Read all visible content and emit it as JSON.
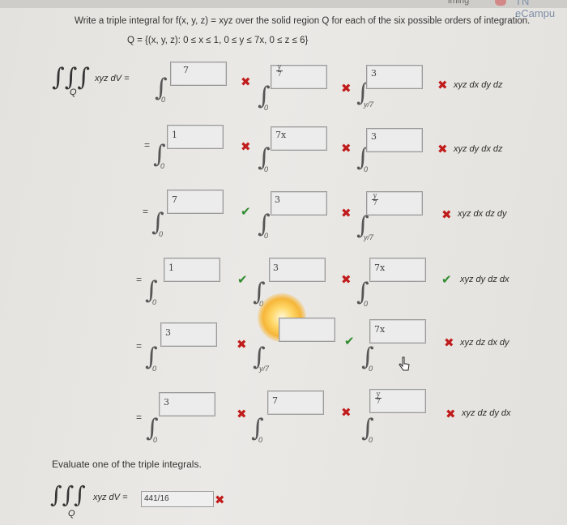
{
  "topbar": {
    "left_text": "iming",
    "brand": "TN eCampu"
  },
  "problem": {
    "statement": "Write a triple integral for f(x, y, z) = xyz over the solid region Q for each of the six possible orders of integration.",
    "region": "Q = {(x, y, z): 0 ≤ x ≤ 1, 0 ≤ y ≤ 7x, 0 ≤ z ≤ 6}",
    "triple_integral_symbol": "∫∫∫",
    "integrand_label": "xyz dV =",
    "region_symbol": "Q"
  },
  "eq": "=",
  "rows": [
    {
      "upper1": "7",
      "lower1": "0",
      "upper2_num": "y",
      "upper2_den": "7",
      "lower2": "0",
      "upper3": "3",
      "lower3": "y/7",
      "order": "xyz dx dy dz"
    },
    {
      "upper1": "1",
      "lower1": "0",
      "upper2": "7x",
      "lower2": "0",
      "upper3": "3",
      "lower3": "0",
      "order": "xyz dy dx dz"
    },
    {
      "upper1": "7",
      "lower1": "0",
      "upper2": "3",
      "lower2": "0",
      "upper3_num": "y",
      "upper3_den": "7",
      "lower3": "y/7",
      "order": "xyz dx dz dy"
    },
    {
      "upper1": "1",
      "lower1": "0",
      "upper2": "3",
      "lower2": "0",
      "upper3": "7x",
      "lower3": "0",
      "order": "xyz dy dz dx"
    },
    {
      "upper1": "3",
      "lower1": "0",
      "lower2": "y/7",
      "upper3": "7x",
      "lower3": "0",
      "order": "xyz dz dx dy"
    },
    {
      "upper1": "3",
      "lower1": "0",
      "upper2": "7",
      "lower2": "0",
      "upper3_num": "y",
      "upper3_den": "7",
      "lower3": "0",
      "order": "xyz dz dy dx"
    }
  ],
  "evaluate": {
    "heading": "Evaluate one of the triple integrals.",
    "answer": "441/16"
  }
}
